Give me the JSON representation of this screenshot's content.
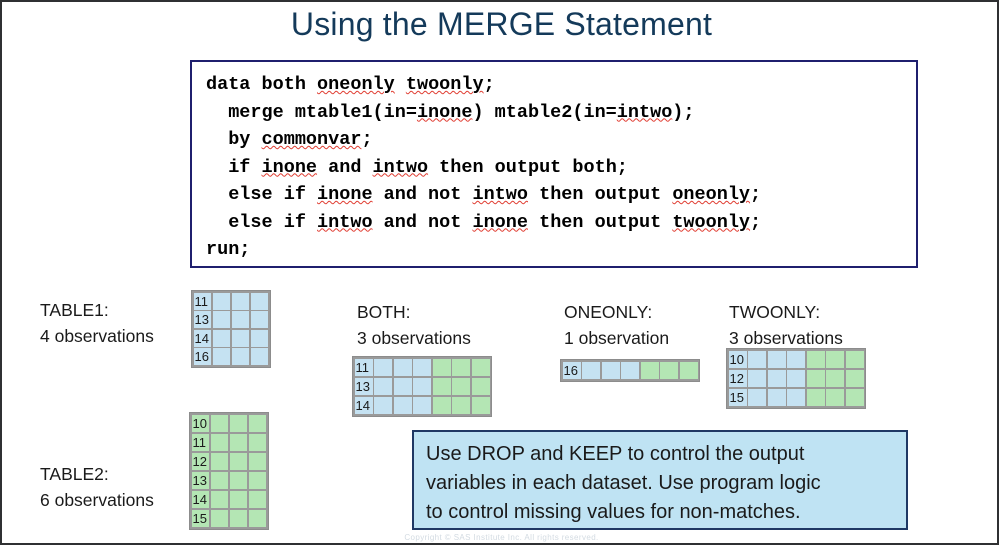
{
  "slide": {
    "title": "Using the MERGE Statement",
    "copyright": "Copyright © SAS Institute Inc. All rights reserved."
  },
  "code_block": {
    "lines": [
      "data both oneonly twoonly;",
      "  merge mtable1(in=inone) mtable2(in=intwo);",
      "  by commonvar;",
      "  if inone and intwo then output both;",
      "  else if inone and not intwo then output oneonly;",
      "  else if intwo and not inone then output twoonly;",
      "run;"
    ],
    "line1": {
      "t1": "data both ",
      "u1": "oneonly",
      "t2": " ",
      "u2": "twoonly",
      "t3": ";"
    },
    "line2": {
      "t1": "  merge mtable1(in=",
      "u1": "inone",
      "t2": ") mtable2(in=",
      "u2": "intwo",
      "t3": ");"
    },
    "line3": {
      "t1": "  by ",
      "u1": "commonvar",
      "t2": ";"
    },
    "line4": {
      "t1": "  if ",
      "u1": "inone",
      "t2": " and ",
      "u2": "intwo",
      "t3": " then output both;"
    },
    "line5": {
      "t1": "  else if ",
      "u1": "inone",
      "t2": " and not ",
      "u2": "intwo",
      "t3": " then output ",
      "u3": "oneonly",
      "t4": ";"
    },
    "line6": {
      "t1": "  else if ",
      "u1": "intwo",
      "t2": " and not ",
      "u2": "inone",
      "t3": " then output ",
      "u3": "twoonly",
      "t4": ";"
    },
    "line7": {
      "t1": "run;"
    }
  },
  "datasets": {
    "table1": {
      "name": "TABLE1:",
      "count_text": "4 observations",
      "rows": 4,
      "cols": 4,
      "blue_cols": 4,
      "green_cols": 0,
      "keys": [
        "11",
        "13",
        "14",
        "16"
      ]
    },
    "table2": {
      "name": "TABLE2:",
      "count_text": "6 observations",
      "rows": 6,
      "cols": 4,
      "blue_cols": 0,
      "green_cols": 4,
      "keys": [
        "10",
        "11",
        "12",
        "13",
        "14",
        "15"
      ]
    },
    "both": {
      "name": "BOTH:",
      "count_text": "3 observations",
      "rows": 3,
      "cols": 7,
      "blue_cols": 4,
      "green_cols": 3,
      "keys": [
        "11",
        "13",
        "14"
      ]
    },
    "oneonly": {
      "name": "ONEONLY:",
      "count_text": "1 observation",
      "rows": 1,
      "cols": 7,
      "blue_cols": 4,
      "green_cols": 3,
      "keys": [
        "16"
      ]
    },
    "twoonly": {
      "name": "TWOONLY:",
      "count_text": "3 observations",
      "rows": 3,
      "cols": 7,
      "blue_cols": 4,
      "green_cols": 3,
      "keys": [
        "10",
        "12",
        "15"
      ]
    }
  },
  "callout": {
    "lines": [
      "Use DROP and KEEP to control the output",
      "variables in each dataset. Use program logic",
      "to control missing values for non-matches."
    ],
    "line1": "Use DROP and KEEP to control the output",
    "line2": "variables in each dataset. Use program logic",
    "line3": "to control missing values for non-matches."
  },
  "colors": {
    "title": "#143a5a",
    "code_border": "#1f1f6e",
    "table1_fill": "#c5e2f2",
    "table2_fill": "#b4e6b4",
    "cell_border": "#9a9a9a",
    "callout_fill": "#bfe3f3",
    "callout_border": "#1f3864",
    "spellcheck_underline": "#e03c31"
  }
}
